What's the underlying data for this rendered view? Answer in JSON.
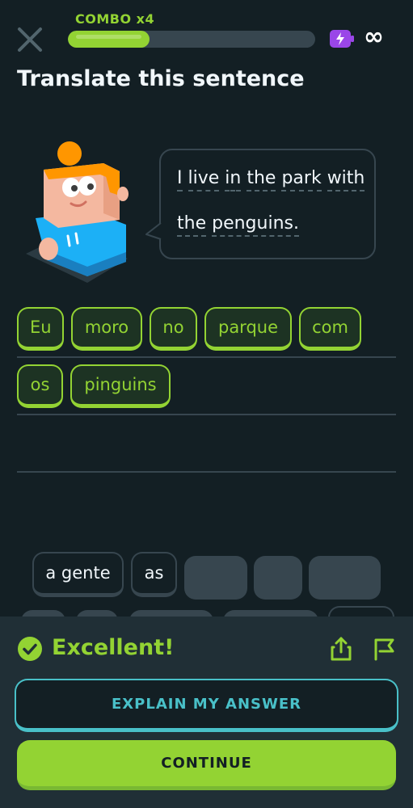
{
  "header": {
    "combo_label": "COMBO x4",
    "progress": 0.33,
    "infinity_symbol": "∞"
  },
  "title": "Translate this sentence",
  "bubble": {
    "line1": [
      "I",
      "live",
      "in",
      "the",
      "park",
      "with"
    ],
    "line2": [
      "the",
      "penguins."
    ]
  },
  "answer_words": [
    "Eu",
    "moro",
    "no",
    "parque",
    "com",
    "os",
    "pinguins"
  ],
  "word_bank": [
    "a gente",
    "as"
  ],
  "feedback": {
    "title": "Excellent!",
    "explain_label": "EXPLAIN MY ANSWER",
    "continue_label": "CONTINUE"
  },
  "colors": {
    "background": "#131f24",
    "accent_green": "#93d333",
    "accent_teal": "#49c0c8",
    "energy_purple": "#9a46e8",
    "panel": "#202f36"
  },
  "icons": [
    "close-icon",
    "energy-icon",
    "check-circle-icon",
    "share-icon",
    "flag-icon"
  ]
}
